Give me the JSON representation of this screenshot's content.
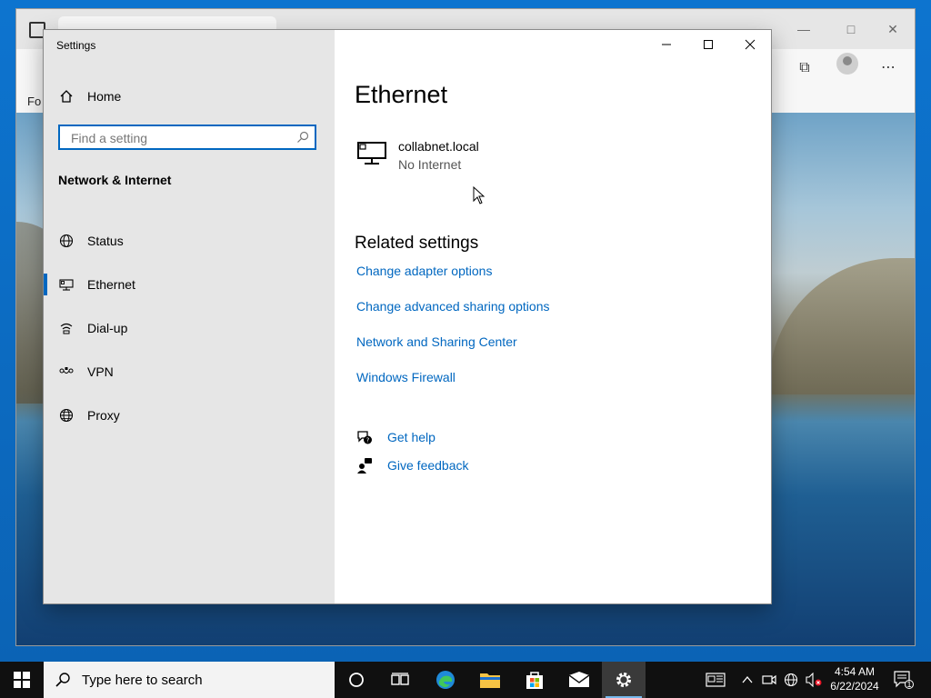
{
  "settings_window": {
    "title": "Settings",
    "nav": {
      "home_label": "Home",
      "search_placeholder": "Find a setting",
      "section_title": "Network & Internet",
      "items": [
        {
          "label": "Status",
          "icon": "status-globe-icon",
          "selected": false
        },
        {
          "label": "Ethernet",
          "icon": "ethernet-icon",
          "selected": true
        },
        {
          "label": "Dial-up",
          "icon": "dialup-icon",
          "selected": false
        },
        {
          "label": "VPN",
          "icon": "vpn-icon",
          "selected": false
        },
        {
          "label": "Proxy",
          "icon": "proxy-globe-icon",
          "selected": false
        }
      ]
    },
    "main": {
      "title": "Ethernet",
      "network": {
        "name": "collabnet.local",
        "status": "No Internet",
        "icon": "monitor-network-icon"
      },
      "related_title": "Related settings",
      "links": [
        "Change adapter options",
        "Change advanced sharing options",
        "Network and Sharing Center",
        "Windows Firewall"
      ],
      "help": {
        "get_help": "Get help",
        "give_feedback": "Give feedback"
      }
    },
    "accent_color": "#0067c0"
  },
  "background_browser": {
    "favorites_bar_text": "Fo"
  },
  "taskbar": {
    "search_placeholder": "Type here to search",
    "time": "4:54 AM",
    "date": "6/22/2024",
    "notification_count": "1"
  }
}
